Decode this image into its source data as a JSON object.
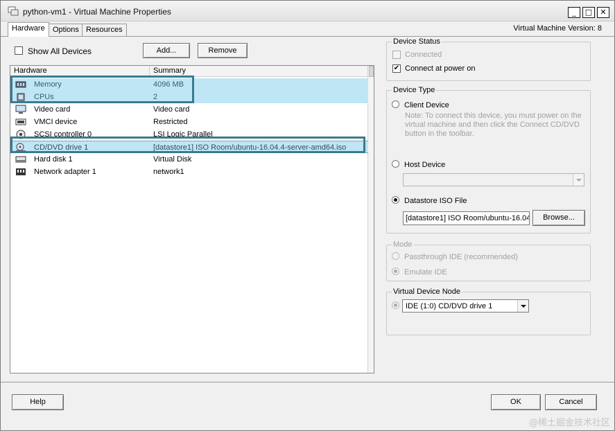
{
  "window": {
    "title": "python-vm1 - Virtual Machine Properties",
    "controls": {
      "minimize": "_",
      "maximize": "□",
      "close": "✕"
    }
  },
  "tabs": [
    {
      "label": "Hardware",
      "active": true
    },
    {
      "label": "Options",
      "active": false
    },
    {
      "label": "Resources",
      "active": false
    }
  ],
  "vm_version": "Virtual Machine Version: 8",
  "hardware_panel": {
    "show_all_devices": {
      "label": "Show All Devices",
      "checked": false
    },
    "add_button": "Add...",
    "remove_button": "Remove",
    "columns": [
      "Hardware",
      "Summary"
    ],
    "devices": [
      {
        "icon": "memory-icon",
        "name": "Memory",
        "summary": "4096 MB"
      },
      {
        "icon": "cpu-icon",
        "name": "CPUs",
        "summary": "2"
      },
      {
        "icon": "video-card-icon",
        "name": "Video card",
        "summary": "Video card"
      },
      {
        "icon": "vmci-device-icon",
        "name": "VMCI device",
        "summary": "Restricted"
      },
      {
        "icon": "scsi-controller-icon",
        "name": "SCSI controller 0",
        "summary": "LSI Logic Parallel"
      },
      {
        "icon": "cd-dvd-drive-icon",
        "name": "CD/DVD drive 1",
        "summary": "[datastore1] ISO Room/ubuntu-16.04.4-server-amd64.iso"
      },
      {
        "icon": "hard-disk-icon",
        "name": "Hard disk 1",
        "summary": "Virtual Disk"
      },
      {
        "icon": "network-adapter-icon",
        "name": "Network adapter 1",
        "summary": "network1"
      }
    ]
  },
  "device_status": {
    "title": "Device Status",
    "connected": {
      "label": "Connected",
      "checked": false,
      "enabled": false
    },
    "connect_at_power_on": {
      "label": "Connect at power on",
      "checked": true,
      "enabled": true
    }
  },
  "device_type": {
    "title": "Device Type",
    "client_device": {
      "label": "Client Device",
      "note": [
        "Note: To connect this device, you must power on the",
        "virtual machine and then click the Connect CD/DVD",
        "button in the toolbar."
      ]
    },
    "host_device": {
      "label": "Host Device",
      "value": ""
    },
    "datastore_iso": {
      "label": "Datastore ISO File",
      "selected": true,
      "value": "[datastore1] ISO Room/ubuntu-16.04.4-server-amd64.iso",
      "browse_button": "Browse..."
    }
  },
  "mode": {
    "title": "Mode",
    "options": [
      {
        "label": "Passthrough IDE (recommended)",
        "selected": false
      },
      {
        "label": "Emulate IDE",
        "selected": true
      }
    ]
  },
  "virtual_device_node": {
    "title": "Virtual Device Node",
    "value": "IDE (1:0) CD/DVD drive 1"
  },
  "footer": {
    "help": "Help",
    "ok": "OK",
    "cancel": "Cancel"
  },
  "watermark": "@稀土掘金技术社区",
  "colors": {
    "highlight": "#bfe6f5",
    "highlight_border": "#3a7a92"
  }
}
